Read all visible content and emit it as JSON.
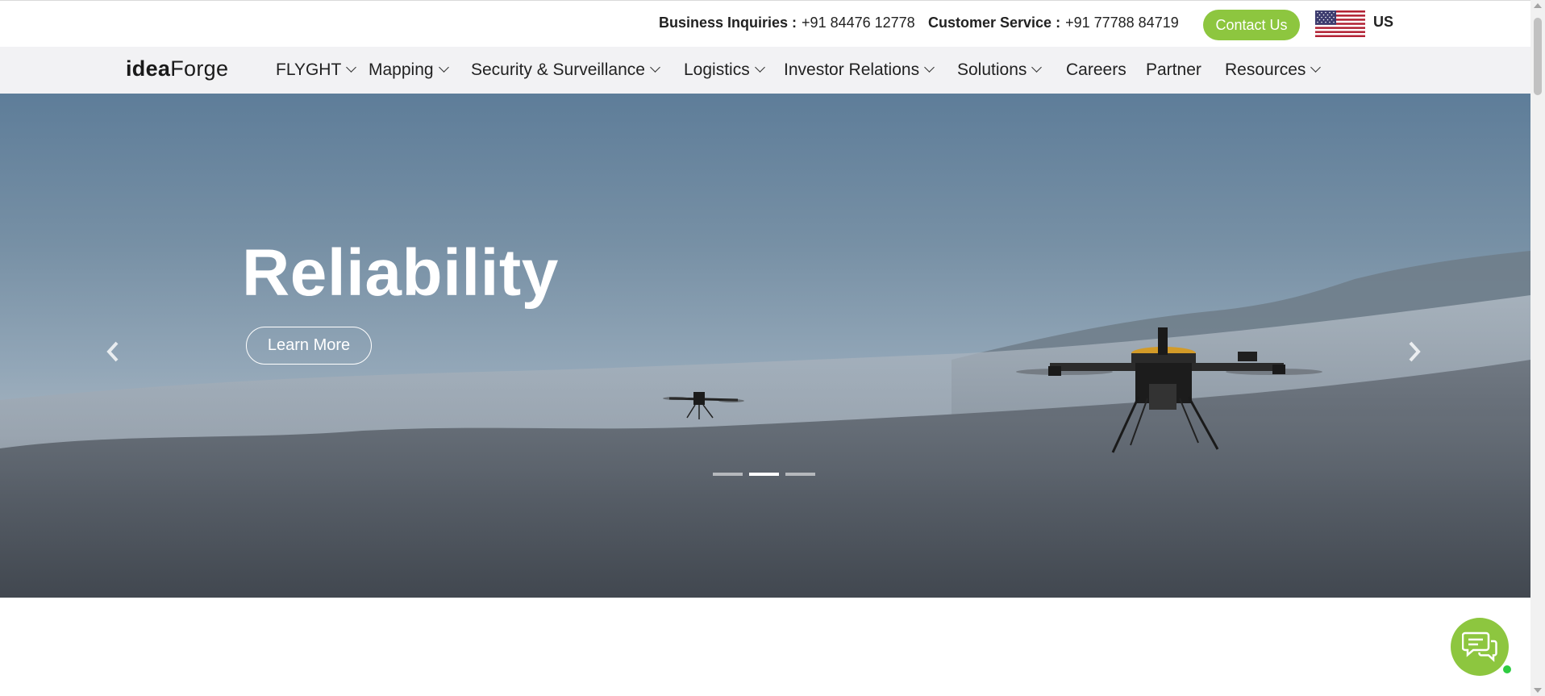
{
  "topbar": {
    "business_label": "Business Inquiries :",
    "business_phone": "+91 84476 12778",
    "customer_label": "Customer Service :",
    "customer_phone": "+91 77788 84719",
    "contact_button": "Contact Us",
    "region": "US",
    "flag_icon": "us-flag-icon"
  },
  "nav": {
    "logo_part1": "idea",
    "logo_part2": "Forge",
    "items": [
      {
        "label": "FLYGHT",
        "dropdown": true
      },
      {
        "label": "Mapping",
        "dropdown": true
      },
      {
        "label": "Security & Surveillance",
        "dropdown": true
      },
      {
        "label": "Logistics",
        "dropdown": true
      },
      {
        "label": "Investor Relations",
        "dropdown": true
      },
      {
        "label": "Solutions",
        "dropdown": true
      },
      {
        "label": "Careers",
        "dropdown": false
      },
      {
        "label": "Partner",
        "dropdown": false
      },
      {
        "label": "Resources",
        "dropdown": true
      }
    ]
  },
  "hero": {
    "title": "Reliability",
    "button": "Learn More",
    "slides": 3,
    "active_slide": 2,
    "icons": [
      "chevron-left-icon",
      "chevron-right-icon"
    ]
  },
  "chat": {
    "icon": "chat-bubbles-icon",
    "status": "online"
  },
  "colors": {
    "accent": "#8dc63f",
    "nav_bg": "#f2f2f4"
  }
}
